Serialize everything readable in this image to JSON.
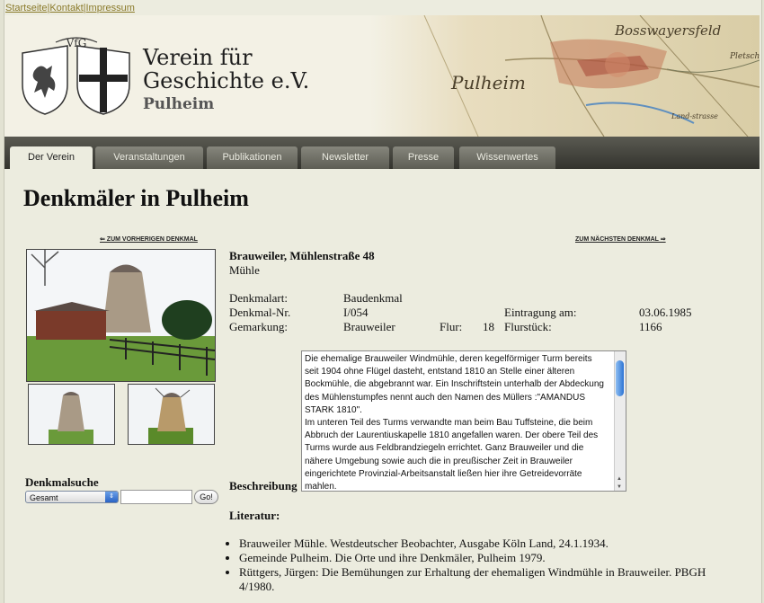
{
  "top_links": [
    "Startseite",
    "Kontakt",
    "Impressum"
  ],
  "top_links_separator": "|",
  "header": {
    "logo_text": "VfG",
    "title_line1": "Verein für",
    "title_line2": "Geschichte e.V.",
    "subtitle": "Pulheim",
    "map_labels": [
      "Bosswayersfeld",
      "Pulheim",
      "Pletsch",
      "Land-strasse"
    ]
  },
  "nav": {
    "tabs": [
      {
        "label": "Der Verein",
        "active": true
      },
      {
        "label": "Veranstaltungen",
        "active": false
      },
      {
        "label": "Publikationen",
        "active": false
      },
      {
        "label": "Newsletter",
        "active": false
      },
      {
        "label": "Presse",
        "active": false
      },
      {
        "label": "Wissenwertes",
        "active": false
      }
    ]
  },
  "page_title": "Denkmäler in Pulheim",
  "pager": {
    "prev": "⇐ ZUM VORHERIGEN DENKMAL",
    "next": "ZUM NÄCHSTEN DENKMAL ⇒"
  },
  "search": {
    "label": "Denkmalsuche",
    "selected": "Gesamt",
    "input_value": "",
    "button": "Go!"
  },
  "monument": {
    "address": "Brauweiler, Mühlenstraße 48",
    "type_name": "Mühle",
    "fields": {
      "art_label": "Denkmalart:",
      "art_value": "Baudenkmal",
      "nr_label": "Denkmal-Nr.",
      "nr_value": "I/054",
      "eintrag_label": "Eintragung am:",
      "eintrag_value": "03.06.1985",
      "gemarkung_label": "Gemarkung:",
      "gemarkung_value": "Brauweiler",
      "flur_label": "Flur:",
      "flur_value": "18",
      "flurstueck_label": "Flurstück:",
      "flurstueck_value": "1166"
    },
    "description_label": "Beschreibung",
    "description": "Die ehemalige Brauweiler Windmühle, deren kegelförmiger Turm bereits seit 1904 ohne Flügel dasteht, entstand 1810 an Stelle einer älteren Bockmühle, die abgebrannt war. Ein Inschriftstein unterhalb der Abdeckung des Mühlenstumpfes nennt auch den Namen des Müllers :\"AMANDUS STARK 1810\".\nIm unteren Teil des Turms verwandte man beim Bau Tuffsteine, die beim Abbruch der Laurentiuskapelle 1810 angefallen waren. Der obere Teil des Turms wurde aus Feldbrandziegeln errichtet. Ganz Brauweiler und die nähere Umgebung sowie auch die in preußischer Zeit in Brauweiler eingerichtete Provinzial-Arbeitsanstalt ließen hier ihre Getreidevorräte mahlen.",
    "literature_label": "Literatur:",
    "literature": [
      "Brauweiler Mühle. Westdeutscher Beobachter, Ausgabe Köln Land, 24.1.1934.",
      "Gemeinde Pulheim. Die Orte und ihre Denkmäler, Pulheim 1979.",
      "Rüttgers, Jürgen: Die Bemühungen zur Erhaltung der ehemaligen Windmühle in Brauweiler. PBGH 4/1980."
    ]
  },
  "colors": {
    "nav_bg": "#3f3f38",
    "tab_bg": "#6f6f66",
    "page_bg": "#ececdf",
    "link": "#8a7a2a",
    "scroll_thumb": "#2c74d4"
  }
}
